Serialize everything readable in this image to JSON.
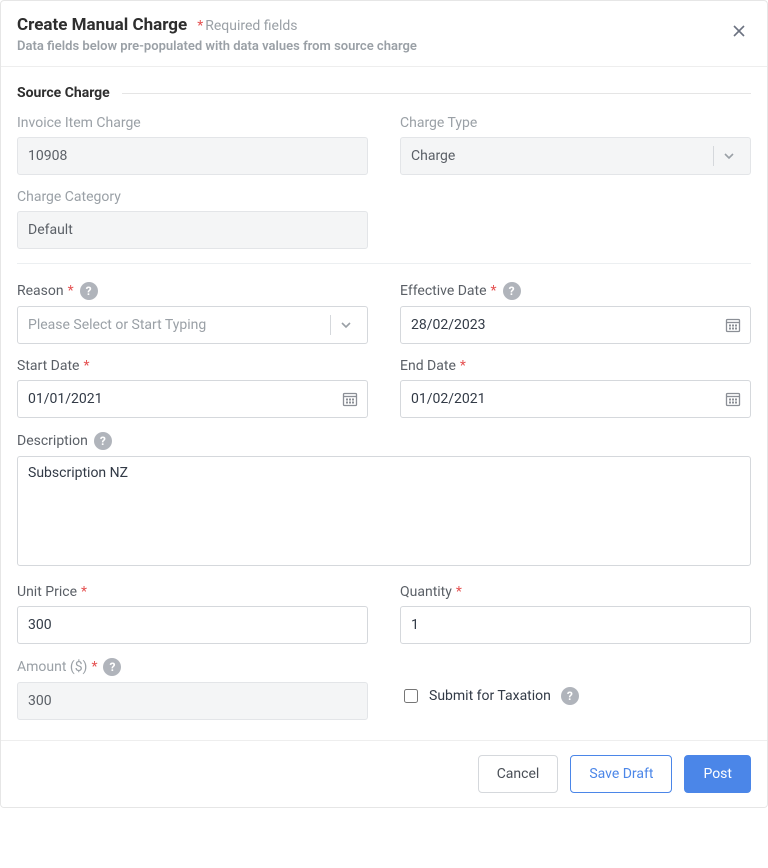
{
  "header": {
    "title": "Create Manual Charge",
    "required_marker": "*",
    "required_label": "Required fields",
    "subtitle": "Data fields below pre-populated with data values from source charge"
  },
  "source": {
    "section_title": "Source Charge",
    "invoice_item_charge_label": "Invoice Item Charge",
    "invoice_item_charge_value": "10908",
    "charge_type_label": "Charge Type",
    "charge_type_value": "Charge",
    "charge_category_label": "Charge Category",
    "charge_category_value": "Default"
  },
  "form": {
    "reason_label": "Reason",
    "reason_placeholder": "Please Select or Start Typing",
    "reason_value": "",
    "effective_date_label": "Effective Date",
    "effective_date_value": "28/02/2023",
    "start_date_label": "Start Date",
    "start_date_value": "01/01/2021",
    "end_date_label": "End Date",
    "end_date_value": "01/02/2021",
    "description_label": "Description",
    "description_value": "Subscription NZ",
    "unit_price_label": "Unit Price",
    "unit_price_value": "300",
    "quantity_label": "Quantity",
    "quantity_value": "1",
    "amount_label": "Amount ($)",
    "amount_value": "300",
    "submit_taxation_label": "Submit for Taxation",
    "submit_taxation_checked": false
  },
  "footer": {
    "cancel": "Cancel",
    "save_draft": "Save Draft",
    "post": "Post"
  },
  "icons": {
    "help_glyph": "?"
  }
}
